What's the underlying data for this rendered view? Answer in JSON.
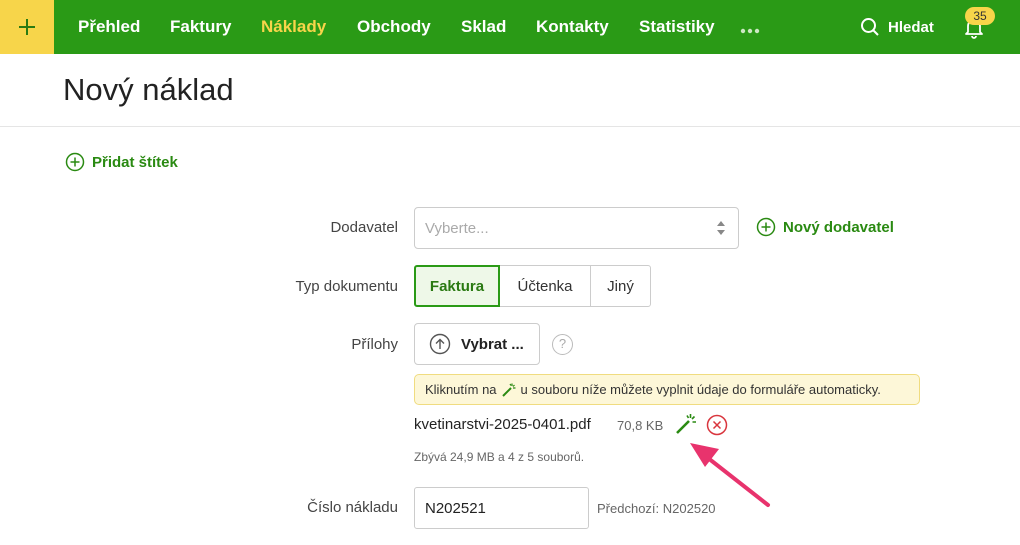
{
  "nav": {
    "items": [
      {
        "label": "Přehled"
      },
      {
        "label": "Faktury"
      },
      {
        "label": "Náklady"
      },
      {
        "label": "Obchody"
      },
      {
        "label": "Sklad"
      },
      {
        "label": "Kontakty"
      },
      {
        "label": "Statistiky"
      }
    ],
    "active": "Náklady",
    "more": "•••",
    "search_label": "Hledat",
    "notifications_count": "35"
  },
  "page": {
    "title": "Nový náklad",
    "add_tag": "Přidat štítek"
  },
  "form": {
    "supplier": {
      "label": "Dodavatel",
      "placeholder": "Vyberte...",
      "new_label": "Nový dodavatel"
    },
    "doc_type": {
      "label": "Typ dokumentu",
      "options": [
        "Faktura",
        "Účtenka",
        "Jiný"
      ],
      "selected": "Faktura"
    },
    "attachments": {
      "label": "Přílohy",
      "button": "Vybrat ...",
      "help": "?",
      "hint_before": "Kliknutím na",
      "hint_after": "u souboru níže můžete vyplnit údaje do formuláře automaticky.",
      "file_name": "kvetinarstvi-2025-0401.pdf",
      "file_size": "70,8 KB",
      "remaining": "Zbývá 24,9 MB a 4 z 5 souborů."
    },
    "number": {
      "label": "Číslo nákladu",
      "value": "N202521",
      "previous": "Předchozí: N202520"
    }
  },
  "colors": {
    "brand_green": "#2a9a16",
    "accent_yellow": "#f7d54a",
    "annotation_pink": "#e8336d"
  }
}
